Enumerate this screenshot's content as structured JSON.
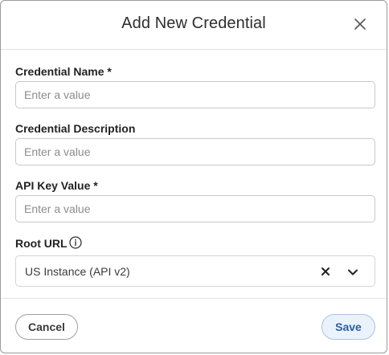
{
  "dialog": {
    "title": "Add New Credential",
    "close_icon": "close-icon"
  },
  "fields": {
    "name": {
      "label": "Credential Name *",
      "placeholder": "Enter a value",
      "value": ""
    },
    "description": {
      "label": "Credential Description",
      "placeholder": "Enter a value",
      "value": ""
    },
    "api_key": {
      "label": "API Key Value *",
      "placeholder": "Enter a value",
      "value": ""
    },
    "root_url": {
      "label": "Root URL",
      "info_icon": "info-icon",
      "selected": "US Instance (API v2)",
      "clear_icon": "clear-icon",
      "dropdown_icon": "chevron-down-icon"
    }
  },
  "footer": {
    "cancel_label": "Cancel",
    "save_label": "Save"
  },
  "colors": {
    "save_bg": "#eaf2fb",
    "save_text": "#2a5fa8",
    "border": "#c9c9c9"
  }
}
